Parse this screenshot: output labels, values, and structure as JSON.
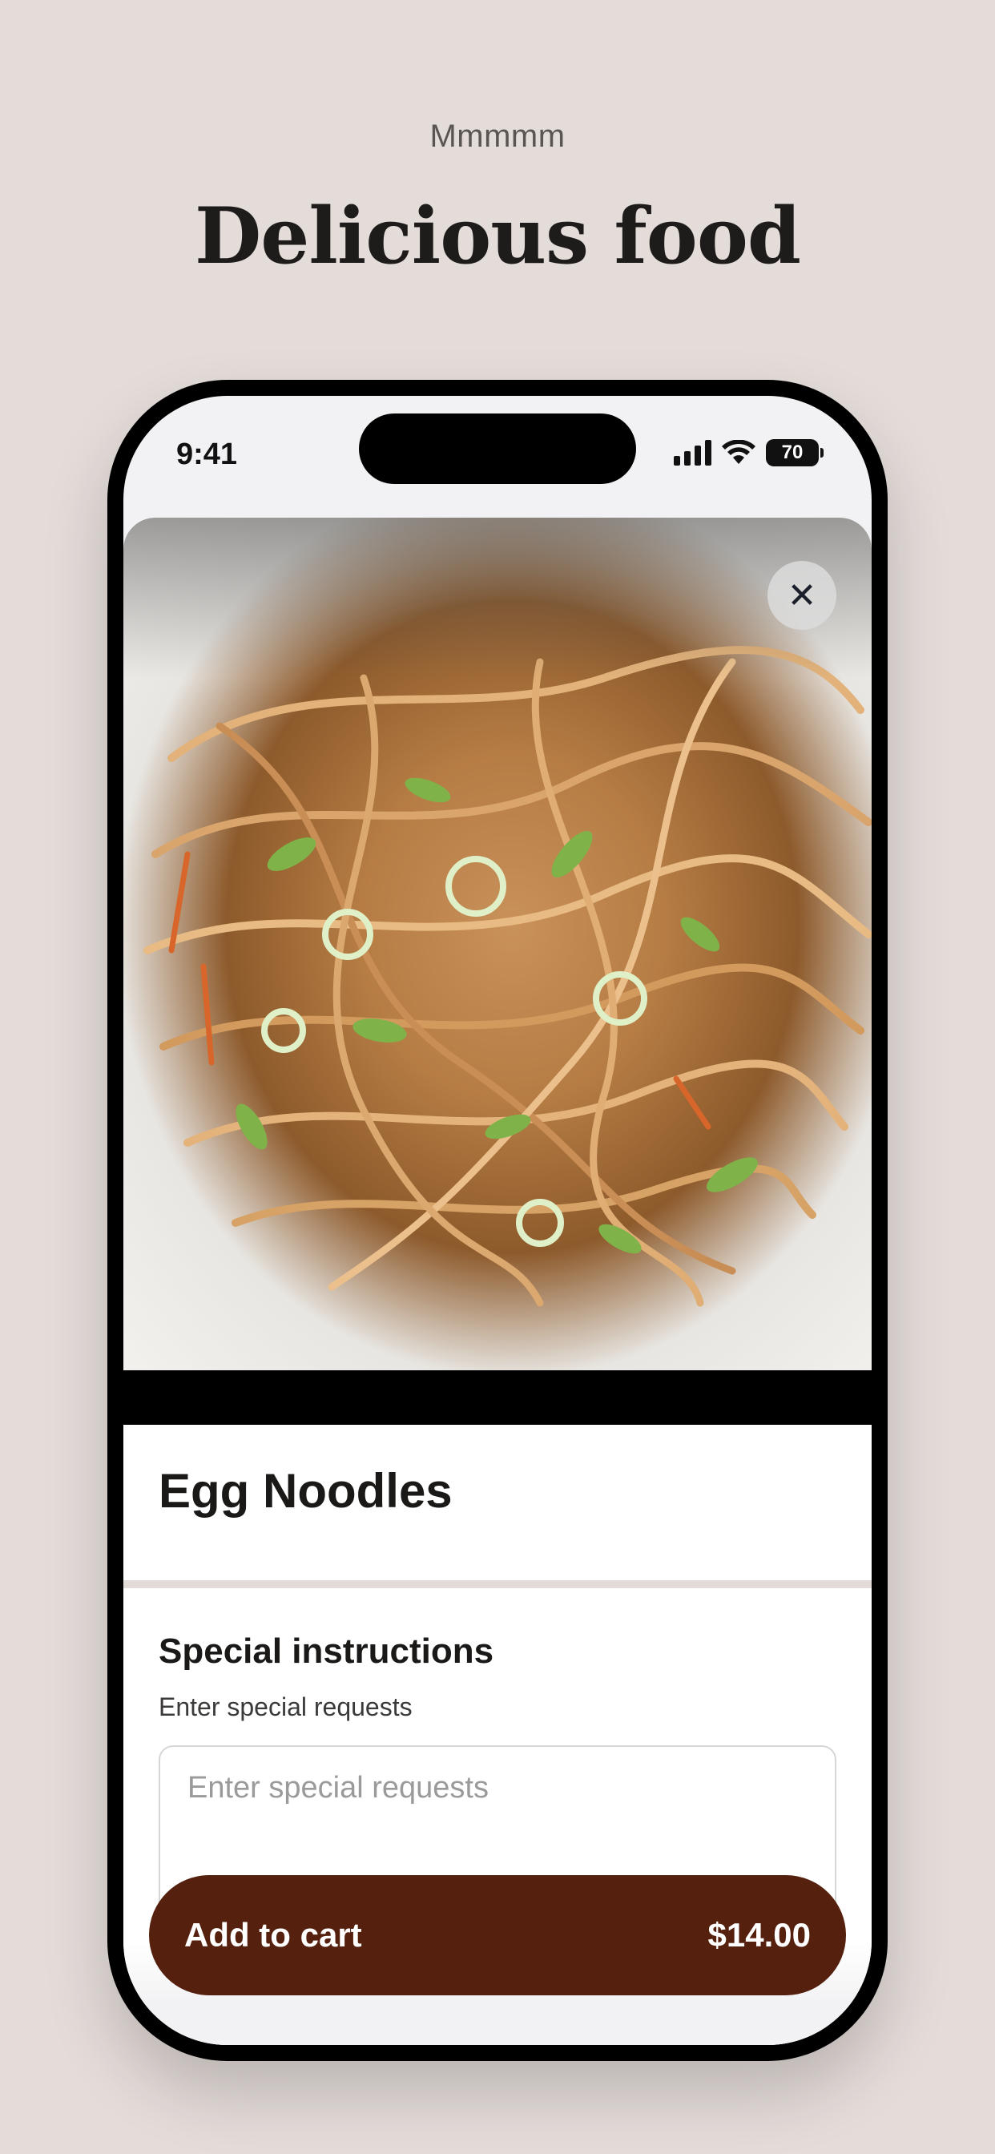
{
  "header": {
    "eyebrow": "Mmmmm",
    "headline": "Delicious food"
  },
  "status_bar": {
    "time": "9:41",
    "battery": "70",
    "icons": [
      "signal-icon",
      "wifi-icon",
      "battery-icon"
    ]
  },
  "item": {
    "image": "egg-noodles-photo",
    "title": "Egg Noodles",
    "close_icon": "close-icon"
  },
  "special_instructions": {
    "title": "Special instructions",
    "subtitle": "Enter special requests",
    "placeholder": "Enter special requests"
  },
  "cart": {
    "label": "Add to cart",
    "price": "$14.00"
  },
  "colors": {
    "background": "#e4dcd9",
    "cart_button": "#56200e",
    "text": "#1b1918"
  }
}
